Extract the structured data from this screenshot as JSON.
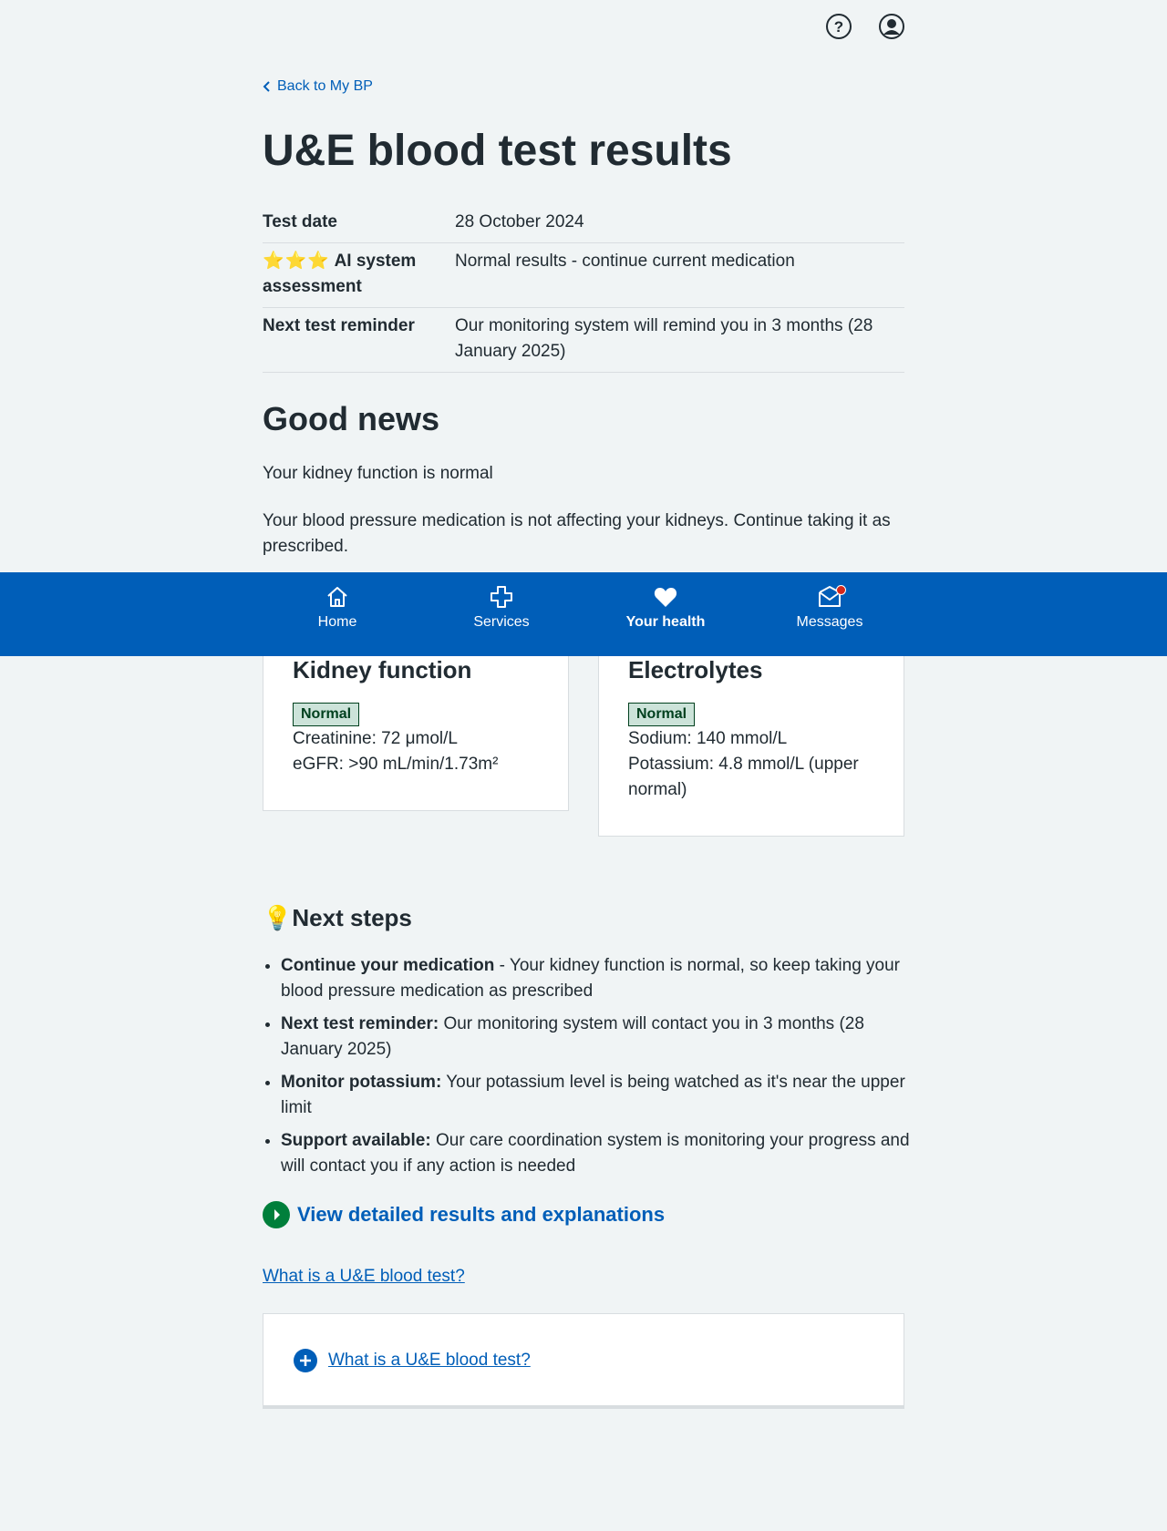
{
  "header": {
    "help_icon": "help-circle-icon",
    "account_icon": "user-circle-icon"
  },
  "back_link": "Back to My BP",
  "page_title": "U&E blood test results",
  "summary": {
    "rows": [
      {
        "key": "Test date",
        "value": "28 October 2024"
      },
      {
        "key_stars": "⭐⭐⭐",
        "key": "AI system assessment",
        "value": "Normal results - continue current medication"
      },
      {
        "key": "Next test reminder",
        "value": "Our monitoring system will remind you in 3 months (28 January 2025)"
      }
    ]
  },
  "good_news": {
    "heading": "Good news",
    "line1": "Your kidney function is normal",
    "line2": "Your blood pressure medication is not affecting your kidneys. Continue taking it as prescribed."
  },
  "nav": {
    "items": [
      {
        "label": "Home",
        "icon": "home-icon"
      },
      {
        "label": "Services",
        "icon": "plus-cross-icon"
      },
      {
        "label": "Your health",
        "icon": "heart-icon",
        "active": true
      },
      {
        "label": "Messages",
        "icon": "envelope-icon",
        "has_notification": true
      }
    ]
  },
  "cards": {
    "kidney": {
      "title": "Kidney function",
      "tag": "Normal",
      "line1": "Creatinine: 72 μmol/L",
      "line2": "eGFR: >90 mL/min/1.73m²"
    },
    "electrolytes": {
      "title": "Electrolytes",
      "tag": "Normal",
      "line1": "Sodium: 140 mmol/L",
      "line2": "Potassium: 4.8 mmol/L (upper normal)"
    }
  },
  "next_steps": {
    "icon": "💡",
    "heading": "Next steps",
    "items": [
      {
        "bold": "Continue your medication",
        "text": " - Your kidney function is normal, so keep taking your blood pressure medication as prescribed"
      },
      {
        "bold": "Next test reminder:",
        "text": " Our monitoring system will contact you in 3 months (28 January 2025)"
      },
      {
        "bold": "Monitor potassium:",
        "text": " Your potassium level is being watched as it's near the upper limit"
      },
      {
        "bold": "Support available:",
        "text": " Our care coordination system is monitoring your progress and will contact you if any action is needed"
      }
    ]
  },
  "action_link": "View detailed results and explanations",
  "ue_link": "What is a U&E blood test?",
  "details": {
    "summary": "What is a U&E blood test?"
  },
  "colors": {
    "nhs_blue": "#005eb8",
    "green": "#007f3b",
    "background": "#f0f4f5",
    "text": "#212b32"
  }
}
